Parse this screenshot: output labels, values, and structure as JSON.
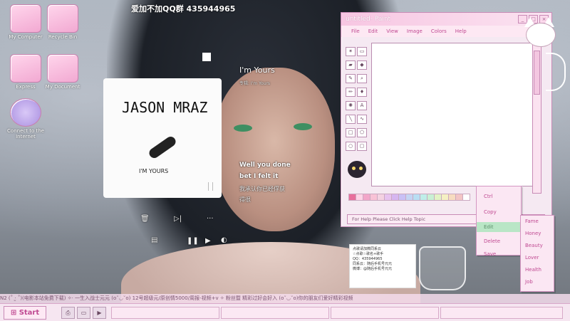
{
  "desktop": {
    "icons": [
      {
        "label": "My Computer",
        "icon": "computer-icon"
      },
      {
        "label": "Recycle Bin",
        "icon": "recycle-bin-icon"
      },
      {
        "label": "Express",
        "icon": "folder-icon"
      },
      {
        "label": "My Document",
        "icon": "document-folder-icon"
      },
      {
        "label": "Connect to the Internet",
        "icon": "globe-icon"
      }
    ]
  },
  "overlay": {
    "qq_text": "爱加不加QQ群  435944965"
  },
  "player": {
    "artist": "JASON MRAZ",
    "album_song": "I'M YOURS",
    "song_title": "I'm Yours",
    "album_line": "专辑:  I'm Yours",
    "lyrics": [
      "Well you done",
      "bet I felt it",
      "我承认你已经俘获",
      "得很"
    ]
  },
  "paint": {
    "title": "untitled- Paint",
    "menu": [
      "File",
      "Edit",
      "View",
      "Image",
      "Colors",
      "Help"
    ],
    "status": "For Help Please Click Help Topic",
    "palette": [
      "#e86f9c",
      "#ffd3e6",
      "#f2a6c9",
      "#f8c2d6",
      "#f4d2e2",
      "#e7c2ef",
      "#d6b6f0",
      "#c9c0f5",
      "#c4d4f3",
      "#b9def3",
      "#bfeee9",
      "#c9f0d4",
      "#e3f3c5",
      "#f5f0c3",
      "#f7dcc0",
      "#f3c5c5",
      "#ffffff"
    ]
  },
  "context_menu": {
    "items": [
      "Ctrl",
      "Copy",
      "Edit",
      "Delete",
      "Save"
    ],
    "submenu": [
      "Fame",
      "Honey",
      "Beauty",
      "Lover",
      "Health",
      "Job"
    ]
  },
  "ticker": {
    "text": "N2   (˚ ·̫ ˚)(电影本站免费下载)  ✧·  一生入战士元元   (o˘◡˘o) 12号超级元/原创情5000/周报-视频+v   ✧ 粉丝暨  精彩过好会好入    (o˘◡˘o)你的朋友们爱好精彩视频"
  },
  "taskbar": {
    "start_label": "Start"
  },
  "note": {
    "line1": "点歌请加微同系云",
    "line2": "☆点歌☆歌名+歌手",
    "line3": "QQ：435944965",
    "line4": "同系云：随后手机号元元",
    "line5": "微博：@随后手机号元元"
  },
  "colors": {
    "accent": "#c04a92",
    "window_bg": "#f5e9f2",
    "title_bar": "#f7c6e2"
  }
}
